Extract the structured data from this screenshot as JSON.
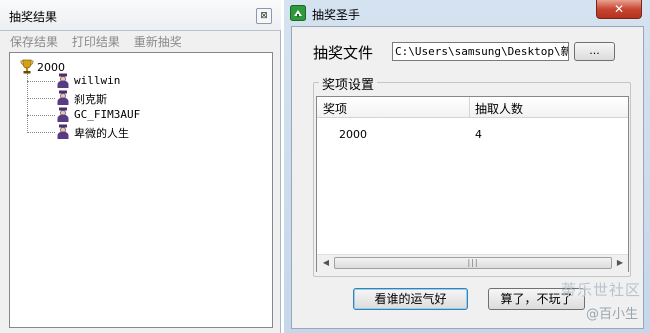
{
  "result_window": {
    "title": "抽奖结果",
    "close_glyph": "⊠",
    "menu": [
      "保存结果",
      "打印结果",
      "重新抽奖"
    ],
    "tree": {
      "root_label": "2000",
      "root_icon": "trophy-icon",
      "children": [
        "willwin",
        "刹克斯",
        "GC_FIM3AUF",
        "卑微的人生"
      ],
      "child_icon": "person-icon"
    }
  },
  "main_window": {
    "title": "抽奖圣手",
    "close_glyph": "✕",
    "file_label": "抽奖文件",
    "file_path": "C:\\Users\\samsung\\Desktop\\新建",
    "browse_label": "...",
    "group_title": "奖项设置",
    "columns": [
      "奖项",
      "抽取人数"
    ],
    "rows": [
      {
        "prize": "2000",
        "count": "4"
      }
    ],
    "scroll_left": "◀",
    "scroll_right": "▶",
    "scroll_grip": "|||",
    "lucky_button": "看谁的运气好",
    "quit_button": "算了，不玩了"
  },
  "watermark": {
    "line1": "蒂乐世社区",
    "line2": "@百小生"
  },
  "colors": {
    "titlebar": "#d5e3f1",
    "close_red": "#c84631",
    "window_bg": "#f0f0f0"
  }
}
